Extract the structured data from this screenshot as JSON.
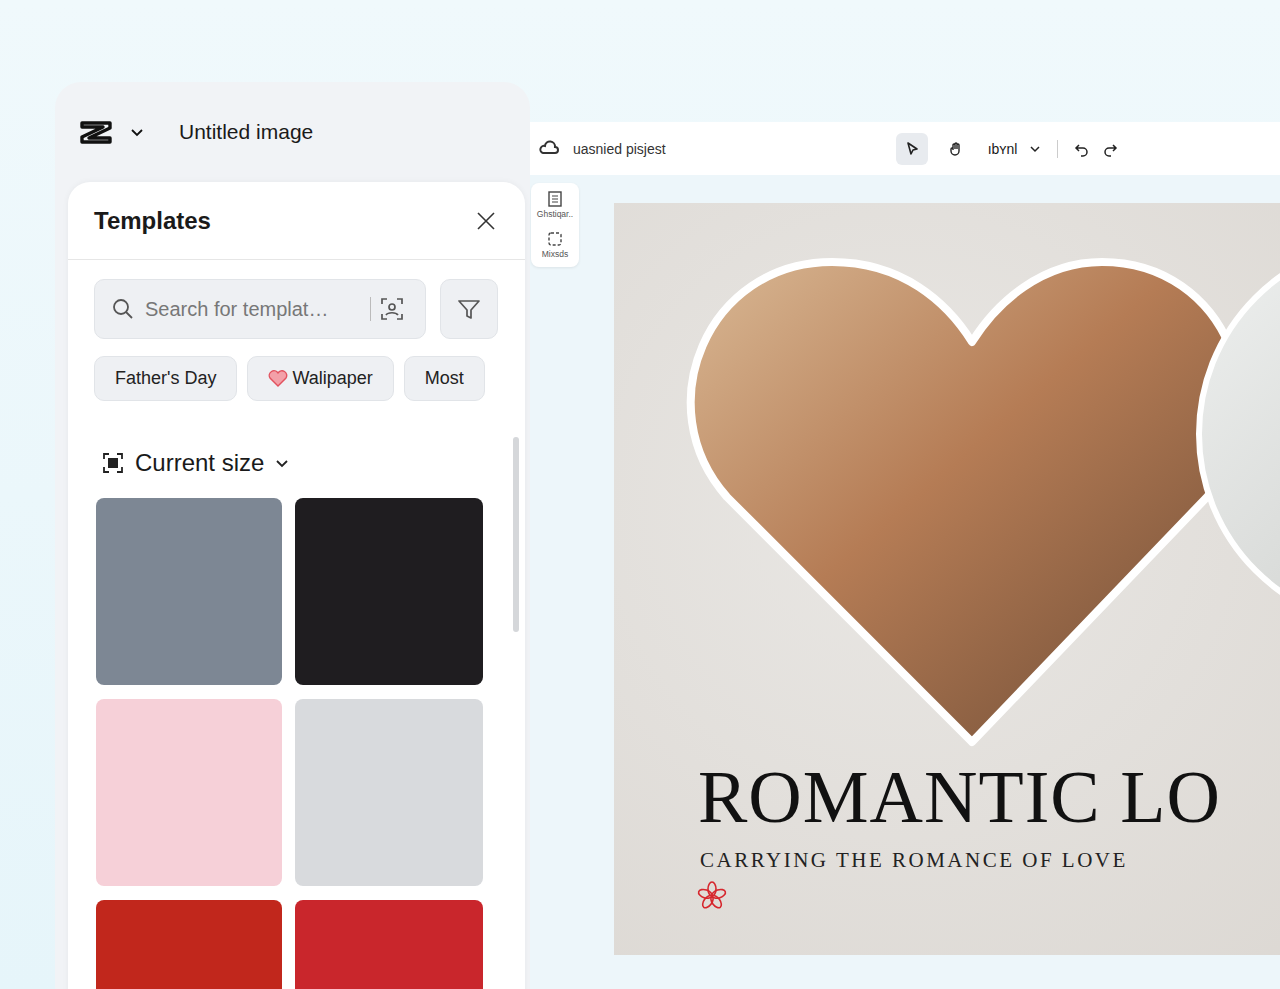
{
  "app": {
    "title": "Untitled image"
  },
  "templates_panel": {
    "title": "Templates",
    "search": {
      "placeholder": "Search for templat…"
    },
    "chips": [
      {
        "label": "Father's Day",
        "kind": "plain"
      },
      {
        "label": "Walipaper",
        "kind": "heart"
      },
      {
        "label": "Most",
        "kind": "plain"
      }
    ],
    "size_filter": "Current size",
    "cards": [
      {
        "color": "#7d8794"
      },
      {
        "color": "#1f1d20"
      },
      {
        "color": "#f6d0d8"
      },
      {
        "color": "#d8dadd"
      },
      {
        "color": "#c1271c"
      },
      {
        "color": "#c9262c"
      }
    ]
  },
  "editor": {
    "project": "uasnied pisjest",
    "tools": [
      {
        "kind": "select",
        "selected": true
      },
      {
        "kind": "hand",
        "selected": false
      }
    ],
    "zoom": "ıbʏnl",
    "side_tools": [
      {
        "label": "Ghstiqar..",
        "kind": "layers"
      },
      {
        "label": "Mixsds",
        "kind": "resize"
      }
    ],
    "design": {
      "title": "ROMANTIC LO",
      "subtitle": "CARRYING THE ROMANCE OF LOVE"
    }
  }
}
